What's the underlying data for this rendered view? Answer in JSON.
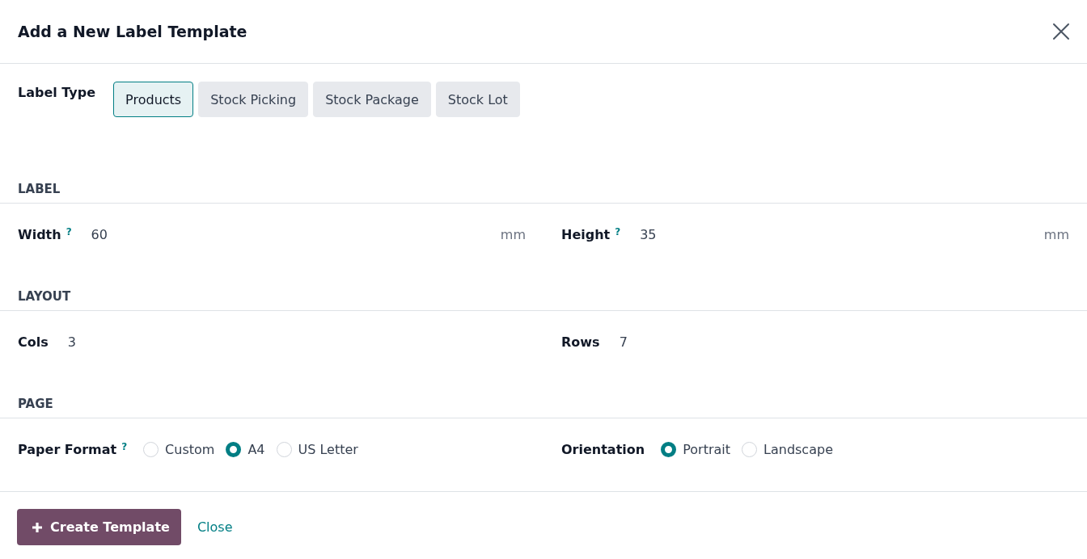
{
  "dialog": {
    "title": "Add a New Label Template"
  },
  "label_type": {
    "label": "Label Type",
    "options": [
      {
        "label": "Products",
        "selected": true
      },
      {
        "label": "Stock Picking",
        "selected": false
      },
      {
        "label": "Stock Package",
        "selected": false
      },
      {
        "label": "Stock Lot",
        "selected": false
      }
    ]
  },
  "sections": [
    {
      "heading": "LABEL",
      "fields": [
        {
          "kind": "input",
          "label": "Width",
          "help": "?",
          "value": "60",
          "unit": "mm"
        },
        {
          "kind": "input",
          "label": "Height",
          "help": "?",
          "value": "35",
          "unit": "mm"
        }
      ]
    },
    {
      "heading": "LAYOUT",
      "fields": [
        {
          "kind": "input",
          "label": "Cols",
          "value": "3"
        },
        {
          "kind": "input",
          "label": "Rows",
          "value": "7"
        }
      ]
    },
    {
      "heading": "PAGE",
      "fields": [
        {
          "kind": "radio",
          "label": "Paper Format",
          "help": "?",
          "options": [
            {
              "label": "Custom",
              "selected": false
            },
            {
              "label": "A4",
              "selected": true
            },
            {
              "label": "US Letter",
              "selected": false
            }
          ]
        },
        {
          "kind": "radio",
          "label": "Orientation",
          "options": [
            {
              "label": "Portrait",
              "selected": true
            },
            {
              "label": "Landscape",
              "selected": false
            }
          ]
        }
      ]
    }
  ],
  "footer": {
    "primary": {
      "label": "Create Template"
    },
    "secondary": {
      "label": "Close"
    }
  }
}
